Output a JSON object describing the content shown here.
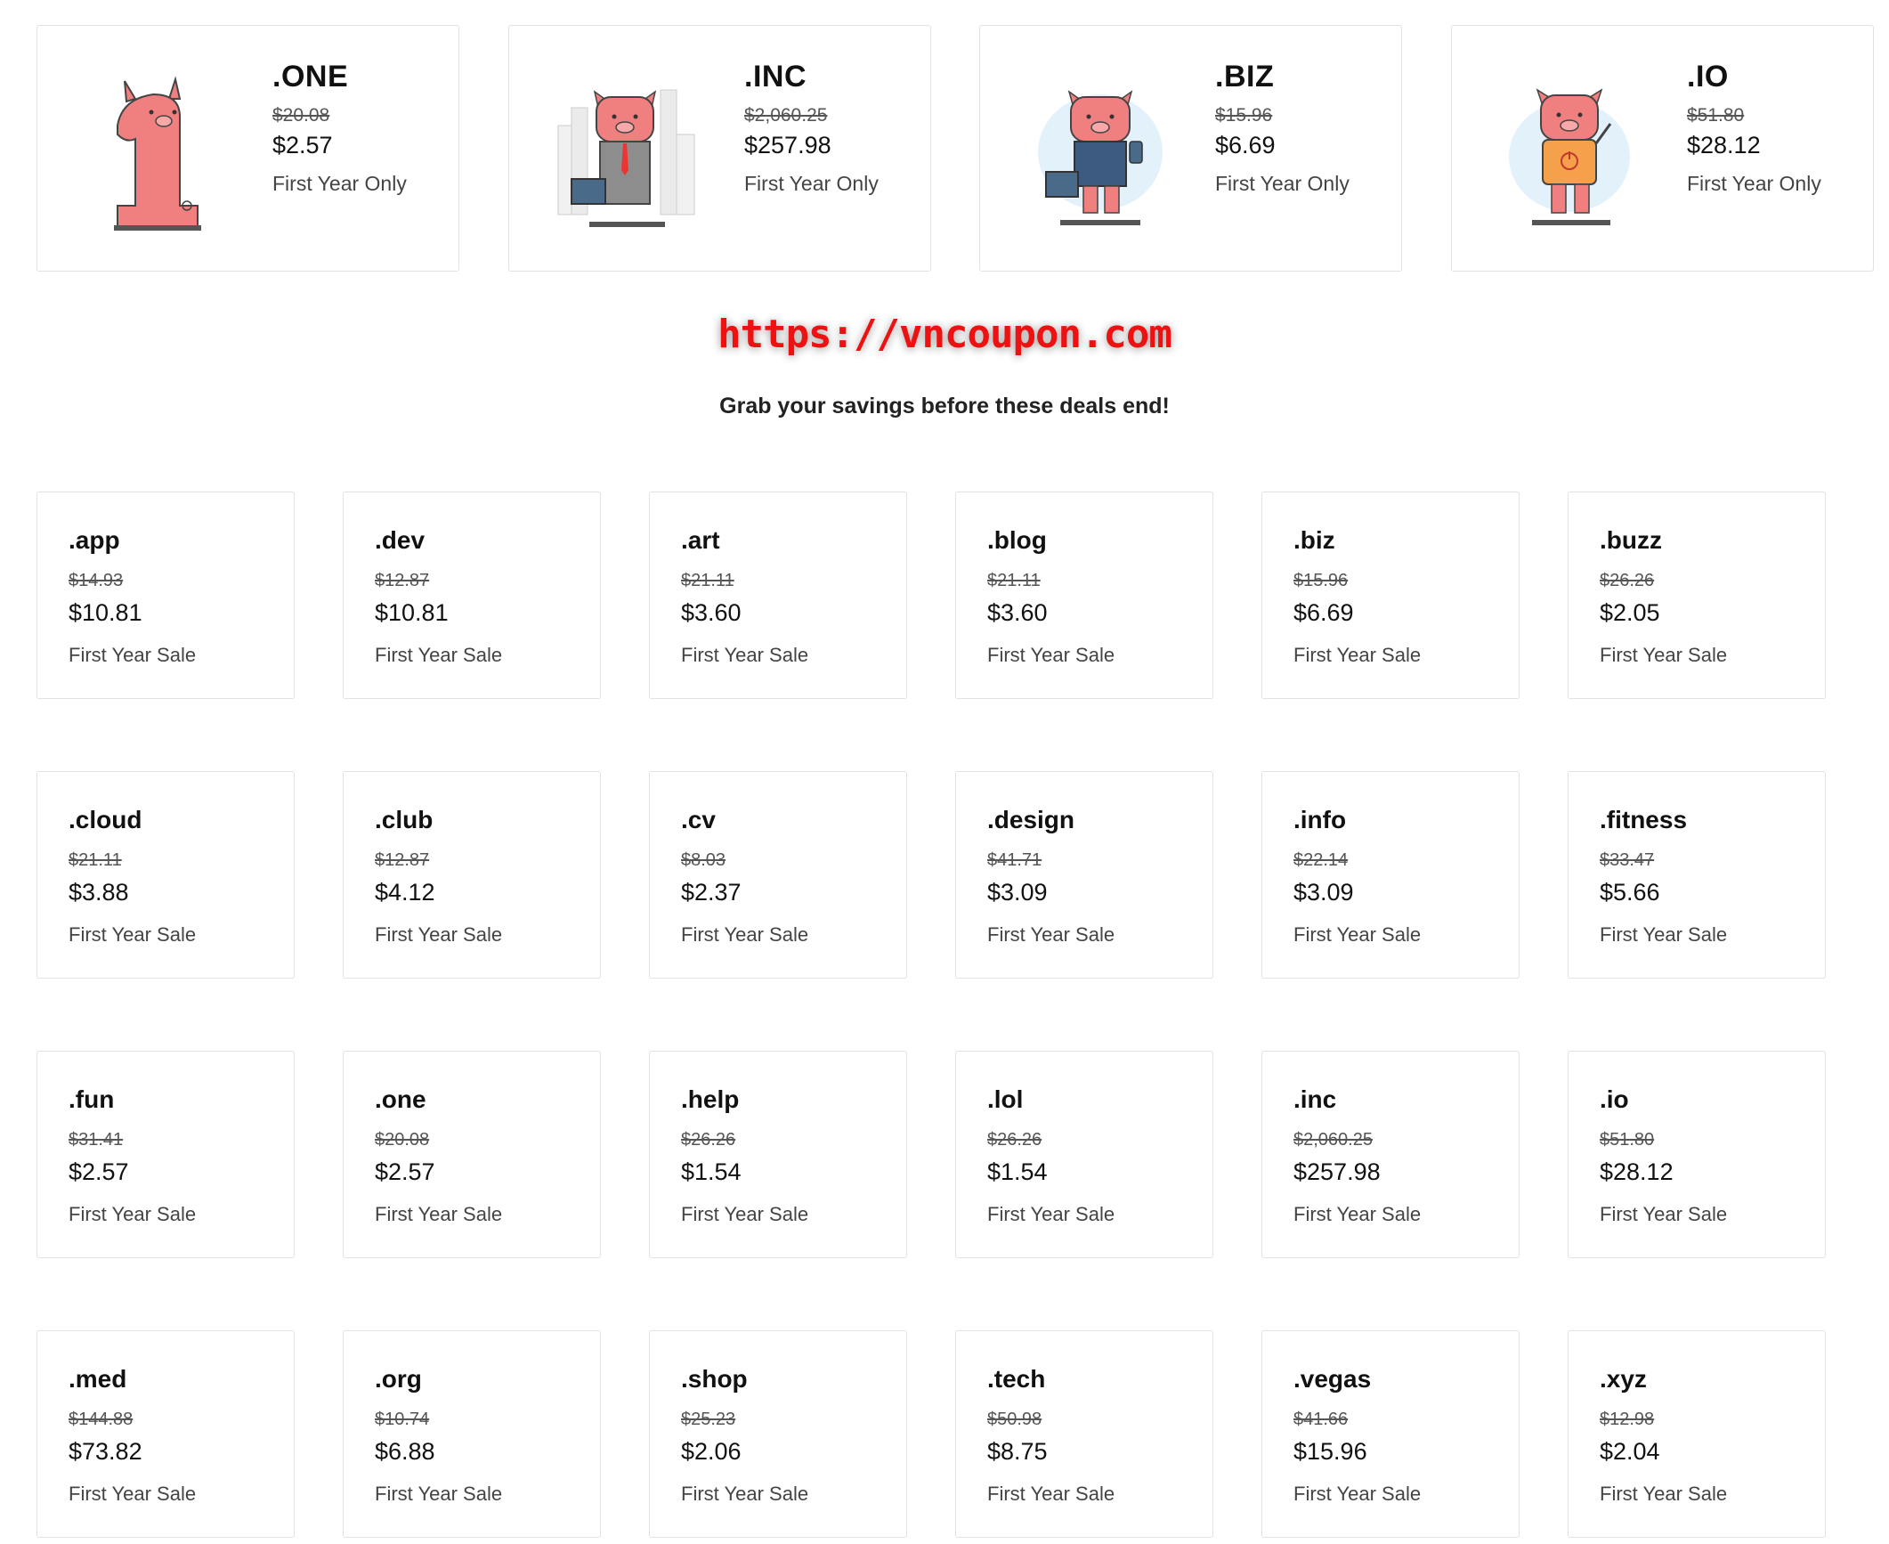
{
  "featured": [
    {
      "tld": ".ONE",
      "old_price": "$20.08",
      "new_price": "$2.57",
      "note": "First Year Only",
      "illustration": "pig-number-one-icon"
    },
    {
      "tld": ".INC",
      "old_price": "$2,060.25",
      "new_price": "$257.98",
      "note": "First Year Only",
      "illustration": "pig-executive-city-icon"
    },
    {
      "tld": ".BIZ",
      "old_price": "$15.96",
      "new_price": "$6.69",
      "note": "First Year Only",
      "illustration": "pig-businessman-icon"
    },
    {
      "tld": ".IO",
      "old_price": "$51.80",
      "new_price": "$28.12",
      "note": "First Year Only",
      "illustration": "pig-tech-shirt-icon"
    }
  ],
  "watermark": "https://vncoupon.com",
  "tagline": "Grab your savings before these deals end!",
  "deals": [
    {
      "tld": ".app",
      "old_price": "$14.93",
      "new_price": "$10.81",
      "note": "First Year Sale"
    },
    {
      "tld": ".dev",
      "old_price": "$12.87",
      "new_price": "$10.81",
      "note": "First Year Sale"
    },
    {
      "tld": ".art",
      "old_price": "$21.11",
      "new_price": "$3.60",
      "note": "First Year Sale"
    },
    {
      "tld": ".blog",
      "old_price": "$21.11",
      "new_price": "$3.60",
      "note": "First Year Sale"
    },
    {
      "tld": ".biz",
      "old_price": "$15.96",
      "new_price": "$6.69",
      "note": "First Year Sale"
    },
    {
      "tld": ".buzz",
      "old_price": "$26.26",
      "new_price": "$2.05",
      "note": "First Year Sale"
    },
    {
      "tld": ".cloud",
      "old_price": "$21.11",
      "new_price": "$3.88",
      "note": "First Year Sale"
    },
    {
      "tld": ".club",
      "old_price": "$12.87",
      "new_price": "$4.12",
      "note": "First Year Sale"
    },
    {
      "tld": ".cv",
      "old_price": "$8.03",
      "new_price": "$2.37",
      "note": "First Year Sale"
    },
    {
      "tld": ".design",
      "old_price": "$41.71",
      "new_price": "$3.09",
      "note": "First Year Sale"
    },
    {
      "tld": ".info",
      "old_price": "$22.14",
      "new_price": "$3.09",
      "note": "First Year Sale"
    },
    {
      "tld": ".fitness",
      "old_price": "$33.47",
      "new_price": "$5.66",
      "note": "First Year Sale"
    },
    {
      "tld": ".fun",
      "old_price": "$31.41",
      "new_price": "$2.57",
      "note": "First Year Sale"
    },
    {
      "tld": ".one",
      "old_price": "$20.08",
      "new_price": "$2.57",
      "note": "First Year Sale"
    },
    {
      "tld": ".help",
      "old_price": "$26.26",
      "new_price": "$1.54",
      "note": "First Year Sale"
    },
    {
      "tld": ".lol",
      "old_price": "$26.26",
      "new_price": "$1.54",
      "note": "First Year Sale"
    },
    {
      "tld": ".inc",
      "old_price": "$2,060.25",
      "new_price": "$257.98",
      "note": "First Year Sale"
    },
    {
      "tld": ".io",
      "old_price": "$51.80",
      "new_price": "$28.12",
      "note": "First Year Sale"
    },
    {
      "tld": ".med",
      "old_price": "$144.88",
      "new_price": "$73.82",
      "note": "First Year Sale"
    },
    {
      "tld": ".org",
      "old_price": "$10.74",
      "new_price": "$6.88",
      "note": "First Year Sale"
    },
    {
      "tld": ".shop",
      "old_price": "$25.23",
      "new_price": "$2.06",
      "note": "First Year Sale"
    },
    {
      "tld": ".tech",
      "old_price": "$50.98",
      "new_price": "$8.75",
      "note": "First Year Sale"
    },
    {
      "tld": ".vegas",
      "old_price": "$41.66",
      "new_price": "$15.96",
      "note": "First Year Sale"
    },
    {
      "tld": ".xyz",
      "old_price": "$12.98",
      "new_price": "$2.04",
      "note": "First Year Sale"
    }
  ],
  "colors": {
    "pig_pink": "#f08080",
    "card_border": "#e2e2e2",
    "watermark_red": "#ee1111"
  }
}
